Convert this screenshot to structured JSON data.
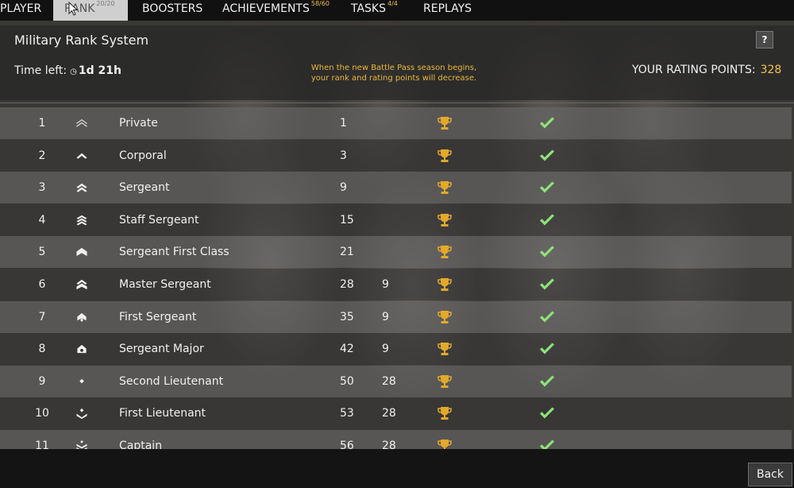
{
  "nav": {
    "tabs": [
      {
        "label": "PLAYER",
        "badge": ""
      },
      {
        "label": "RANK",
        "badge": "20/20"
      },
      {
        "label": "BOOSTERS",
        "badge": ""
      },
      {
        "label": "ACHIEVEMENTS",
        "badge": "58/60"
      },
      {
        "label": "TASKS",
        "badge": "4/4"
      },
      {
        "label": "REPLAYS",
        "badge": ""
      }
    ],
    "active_tab": "RANK"
  },
  "header": {
    "title": "Military Rank System",
    "help_label": "?",
    "time_left_label": "Time left:",
    "time_left_value": "1d 21h",
    "notice": "When the new Battle Pass season begins, your rank and rating points will decrease.",
    "rating_label": "YOUR RATING POINTS:",
    "rating_value": "328"
  },
  "ranks": [
    {
      "num": "1",
      "name": "Private",
      "points": "1",
      "after": "",
      "insignia": "chevron-outline-icon"
    },
    {
      "num": "2",
      "name": "Corporal",
      "points": "3",
      "after": "",
      "insignia": "single-chevron-icon"
    },
    {
      "num": "3",
      "name": "Sergeant",
      "points": "9",
      "after": "",
      "insignia": "double-chevron-icon"
    },
    {
      "num": "4",
      "name": "Staff Sergeant",
      "points": "15",
      "after": "",
      "insignia": "triple-chevron-icon"
    },
    {
      "num": "5",
      "name": "Sergeant First Class",
      "points": "21",
      "after": "",
      "insignia": "chevron-rocker-icon"
    },
    {
      "num": "6",
      "name": "Master Sergeant",
      "points": "28",
      "after": "9",
      "insignia": "double-chevron-rocker-icon"
    },
    {
      "num": "7",
      "name": "First Sergeant",
      "points": "35",
      "after": "9",
      "insignia": "chevron-diamond-icon"
    },
    {
      "num": "8",
      "name": "Sergeant Major",
      "points": "42",
      "after": "9",
      "insignia": "chevron-star-icon"
    },
    {
      "num": "9",
      "name": "Second Lieutenant",
      "points": "50",
      "after": "28",
      "insignia": "diamond-icon"
    },
    {
      "num": "10",
      "name": "First Lieutenant",
      "points": "53",
      "after": "28",
      "insignia": "diamond-chevron-icon"
    },
    {
      "num": "11",
      "name": "Captain",
      "points": "56",
      "after": "28",
      "insignia": "diamond-double-chevron-icon"
    }
  ],
  "row_icons": {
    "reward": "trophy-icon",
    "status": "checkmark-icon"
  },
  "colors": {
    "accent": "#f2c14a",
    "check": "#8ee27a",
    "notice": "#e9b83a"
  },
  "footer": {
    "back_label": "Back"
  }
}
